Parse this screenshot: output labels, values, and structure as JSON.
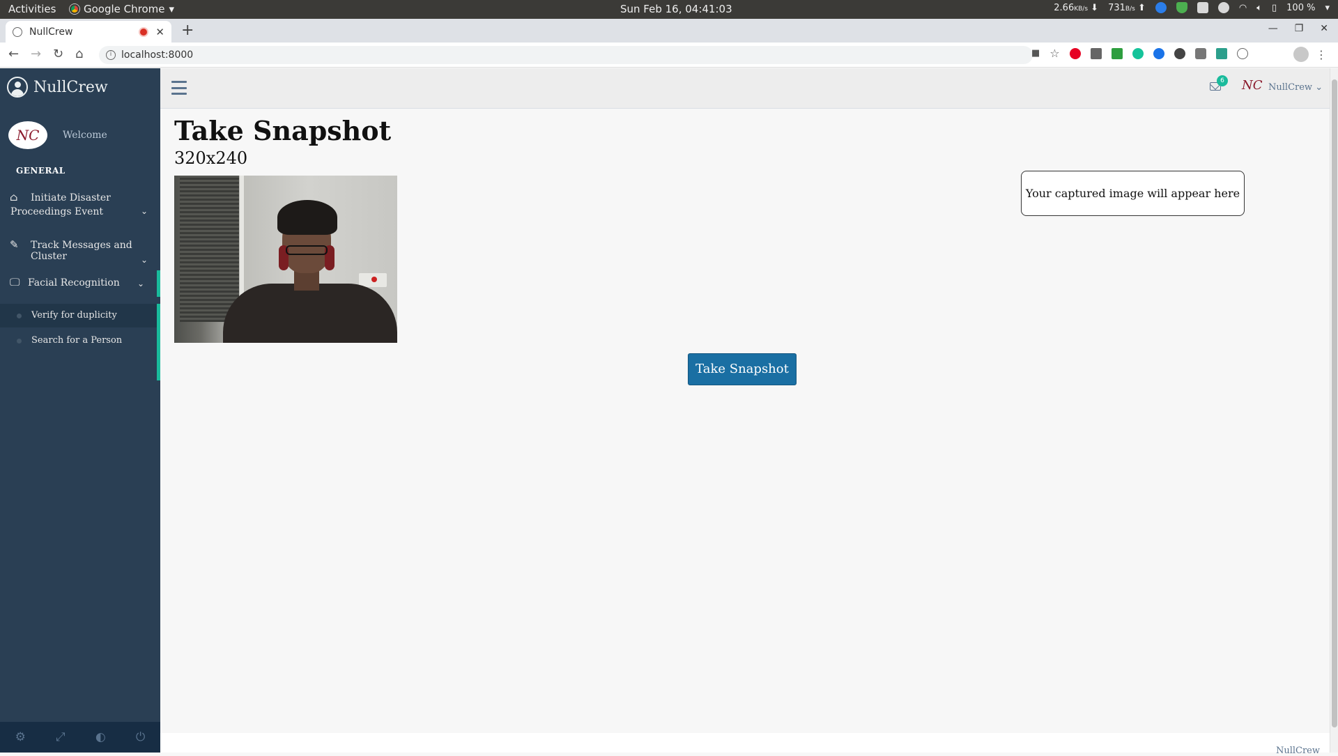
{
  "os": {
    "activities": "Activities",
    "app_name": "Google Chrome",
    "clock": "Sun Feb 16, 04:41:03",
    "net_down": "2.66",
    "net_down_unit": "KB/s",
    "net_up": "731",
    "net_up_unit": "B/s",
    "battery": "100 %"
  },
  "browser": {
    "tab_title": "NullCrew",
    "url": "localhost:8000"
  },
  "sidebar": {
    "brand": "NullCrew",
    "profile_initials": "NC",
    "welcome": "Welcome",
    "section_title": "GENERAL",
    "items": [
      {
        "label": "Initiate Disaster Proceedings Event",
        "icon": "home-icon"
      },
      {
        "label": "Track Messages and Cluster",
        "icon": "edit-icon"
      },
      {
        "label": "Facial Recognition",
        "icon": "desktop-icon"
      }
    ],
    "subitems": [
      {
        "label": "Verify for duplicity",
        "active": true
      },
      {
        "label": "Search for a Person",
        "active": false
      }
    ],
    "footer_icons": [
      "settings-icon",
      "fullscreen-icon",
      "lock-icon",
      "power-icon"
    ]
  },
  "topnav": {
    "mail_badge": "6",
    "user_initials": "NC",
    "user_name": "NullCrew"
  },
  "main": {
    "title": "Take Snapshot",
    "resolution": "320x240",
    "snapshot_button": "Take Snapshot",
    "result_placeholder": "Your captured image will appear here"
  },
  "footer": {
    "text": "NullCrew"
  },
  "colors": {
    "sidebar_bg": "#2a3f54",
    "accent": "#1abb9c",
    "button_bg": "#1a6fa3"
  }
}
